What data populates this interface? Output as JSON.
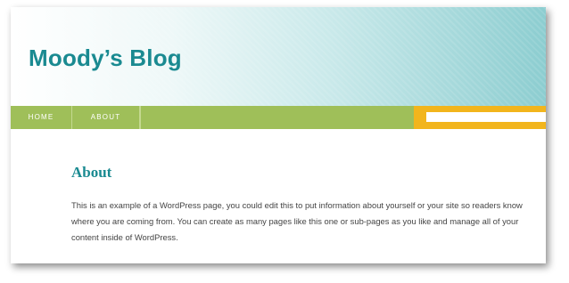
{
  "site": {
    "title": "Moody’s Blog"
  },
  "nav": {
    "items": [
      {
        "label": "HOME"
      },
      {
        "label": "ABOUT"
      }
    ]
  },
  "search": {
    "value": "",
    "placeholder": ""
  },
  "page": {
    "heading": "About",
    "body": "This is an example of a WordPress page, you could edit this to put information about yourself or your site so readers know where you are coming from. You can create as many pages like this one or sub-pages as you like and manage all of your content inside of WordPress."
  },
  "colors": {
    "title": "#1a8a91",
    "nav_bg": "#9fbf59",
    "search_bg": "#f2b51c",
    "header_gradient_end": "#8ccdd0"
  }
}
